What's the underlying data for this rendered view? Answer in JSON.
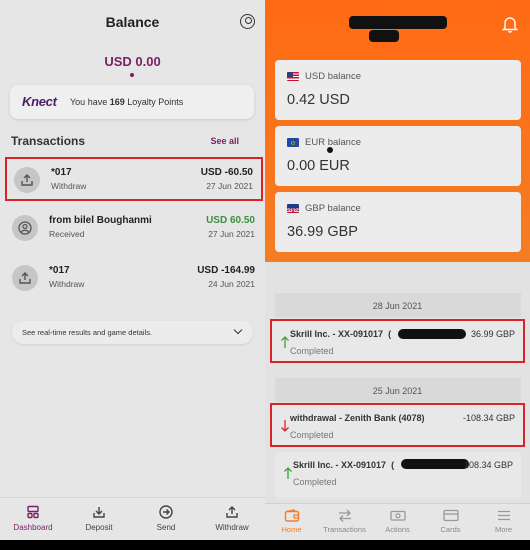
{
  "left": {
    "title": "Balance",
    "balance": "USD 0.00",
    "loyalty": {
      "brand": "Knect",
      "text_pre": "You have ",
      "points": "169",
      "text_post": " Loyalty Points"
    },
    "transactions_heading": "Transactions",
    "see_all": "See all",
    "transactions": [
      {
        "name": "*017",
        "type": "Withdraw",
        "amount": "USD -60.50",
        "date": "27 Jun 2021",
        "positive": false,
        "icon": "upload-icon"
      },
      {
        "name": "from bilel Boughanmi",
        "type": "Received",
        "amount": "USD 60.50",
        "date": "27 Jun 2021",
        "positive": true,
        "icon": "user-icon"
      },
      {
        "name": "*017",
        "type": "Withdraw",
        "amount": "USD -164.99",
        "date": "24 Jun 2021",
        "positive": false,
        "icon": "upload-icon"
      }
    ],
    "expander_text": "See real-time results and game details.",
    "nav": [
      "Dashboard",
      "Deposit",
      "Send",
      "Withdraw"
    ]
  },
  "right": {
    "balances": [
      {
        "label": "USD balance",
        "value": "0.42 USD",
        "flag": "us-flag-icon"
      },
      {
        "label": "EUR balance",
        "value": "0.00 EUR",
        "flag": "eu-flag-icon"
      },
      {
        "label": "GBP balance",
        "value": "36.99 GBP",
        "flag": "uk-flag-icon"
      }
    ],
    "groups": [
      {
        "date": "28 Jun 2021"
      },
      {
        "date": "25 Jun 2021"
      }
    ],
    "transactions": [
      {
        "name": "Skrill Inc. - XX-091017",
        "suffix": "(",
        "amount": "36.99 GBP",
        "status": "Completed",
        "direction": "in"
      },
      {
        "name": "withdrawal - Zenith Bank (4078)",
        "suffix": "",
        "amount": "-108.34 GBP",
        "status": "Completed",
        "direction": "out"
      },
      {
        "name": "Skrill Inc. - XX-091017",
        "suffix": "(",
        "amount": "108.34 GBP",
        "status": "Completed",
        "direction": "in"
      }
    ],
    "nav": [
      "Home",
      "Transactions",
      "Actions",
      "Cards",
      "More"
    ]
  },
  "colors": {
    "brand_purple": "#7a1f63",
    "orange": "#f47d24",
    "positive_green": "#3c8f3c",
    "highlight_red": "#d8232a"
  }
}
